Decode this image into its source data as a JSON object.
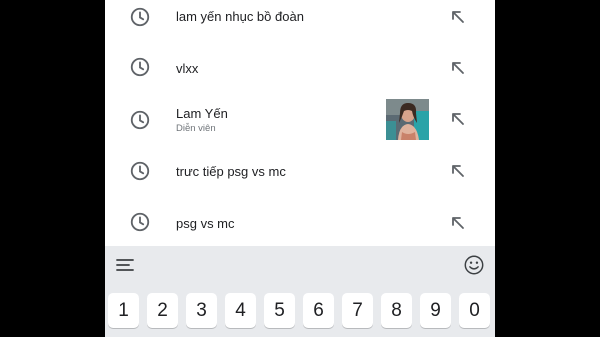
{
  "suggestions": [
    {
      "label": "lam yến nhục bồ đoàn",
      "sublabel": "",
      "has_thumbnail": false,
      "icon": "history-clock-icon",
      "action_icon": "fill-query-arrow-icon"
    },
    {
      "label": "vlxx",
      "sublabel": "",
      "has_thumbnail": false,
      "icon": "history-clock-icon",
      "action_icon": "fill-query-arrow-icon"
    },
    {
      "label": "Lam Yến",
      "sublabel": "Diễn viên",
      "has_thumbnail": true,
      "icon": "history-clock-icon",
      "action_icon": "fill-query-arrow-icon"
    },
    {
      "label": "trưc tiếp psg vs mc",
      "sublabel": "",
      "has_thumbnail": false,
      "icon": "history-clock-icon",
      "action_icon": "fill-query-arrow-icon"
    },
    {
      "label": "psg vs mc",
      "sublabel": "",
      "has_thumbnail": false,
      "icon": "history-clock-icon",
      "action_icon": "fill-query-arrow-icon"
    }
  ],
  "keyboard": {
    "toolbar_left_icon": "menu-lines-icon",
    "toolbar_right_icon": "emoji-smiley-icon",
    "number_keys": [
      "1",
      "2",
      "3",
      "4",
      "5",
      "6",
      "7",
      "8",
      "9",
      "0"
    ]
  },
  "colors": {
    "background": "#000000",
    "panel": "#ffffff",
    "keyboard_bg": "#e8eaed",
    "text_primary": "#202124",
    "text_secondary": "#70757a",
    "icon_gray": "#5f6368"
  }
}
